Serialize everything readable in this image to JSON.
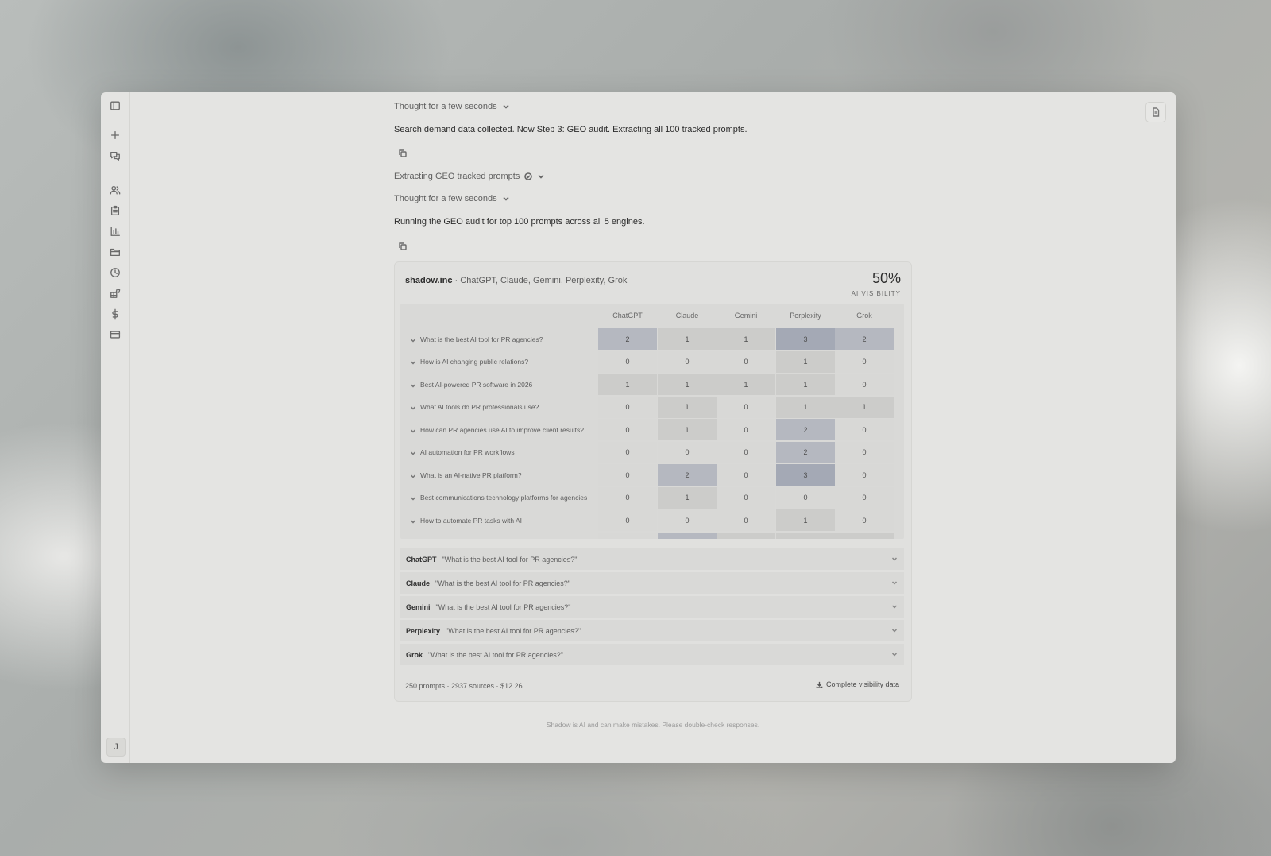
{
  "sidebar": {
    "icons": [
      "panel-toggle-icon",
      "new-chat-icon",
      "chats-icon",
      "people-icon",
      "clipboard-icon",
      "bar-chart-icon",
      "folder-icon",
      "clock-icon",
      "apps-icon",
      "dollar-icon",
      "card-icon"
    ],
    "avatar_initial": "J"
  },
  "chat": {
    "thought1": "Thought for a few seconds",
    "msg1": "Search demand data collected. Now Step 3: GEO audit. Extracting all 100 tracked prompts.",
    "tool_step": "Extracting GEO tracked prompts",
    "thought2": "Thought for a few seconds",
    "msg2": "Running the GEO audit for top 100 prompts across all 5 engines."
  },
  "card": {
    "site": "shadow.inc",
    "engines_line": " · ChatGPT, Claude, Gemini, Perplexity, Grok",
    "visibility_value": "50%",
    "visibility_label": "AI VISIBILITY",
    "columns": [
      "ChatGPT",
      "Claude",
      "Gemini",
      "Perplexity",
      "Grok"
    ],
    "rows": [
      {
        "prompt": "What is the best AI tool for PR agencies?",
        "values": [
          2,
          1,
          1,
          3,
          2
        ]
      },
      {
        "prompt": "How is AI changing public relations?",
        "values": [
          0,
          0,
          0,
          1,
          0
        ]
      },
      {
        "prompt": "Best AI-powered PR software in 2026",
        "values": [
          1,
          1,
          1,
          1,
          0
        ]
      },
      {
        "prompt": "What AI tools do PR professionals use?",
        "values": [
          0,
          1,
          0,
          1,
          1
        ]
      },
      {
        "prompt": "How can PR agencies use AI to improve client results?",
        "values": [
          0,
          1,
          0,
          2,
          0
        ]
      },
      {
        "prompt": "AI automation for PR workflows",
        "values": [
          0,
          0,
          0,
          2,
          0
        ]
      },
      {
        "prompt": "What is an AI-native PR platform?",
        "values": [
          0,
          2,
          0,
          3,
          0
        ]
      },
      {
        "prompt": "Best communications technology platforms for agencies",
        "values": [
          0,
          1,
          0,
          0,
          0
        ]
      },
      {
        "prompt": "How to automate PR tasks with AI",
        "values": [
          0,
          0,
          0,
          1,
          0
        ]
      }
    ],
    "partial_row_levels": [
      0,
      2,
      1,
      1,
      1
    ],
    "responses": [
      {
        "engine": "ChatGPT",
        "query": "\"What is the best AI tool for PR agencies?\""
      },
      {
        "engine": "Claude",
        "query": "\"What is the best AI tool for PR agencies?\""
      },
      {
        "engine": "Gemini",
        "query": "\"What is the best AI tool for PR agencies?\""
      },
      {
        "engine": "Perplexity",
        "query": "\"What is the best AI tool for PR agencies?\""
      },
      {
        "engine": "Grok",
        "query": "\"What is the best AI tool for PR agencies?\""
      }
    ],
    "footer": "250 prompts · 2937 sources · $12.26",
    "download_label": "Complete visibility data"
  },
  "disclaimer": "Shadow is AI and can make mistakes. Please double-check responses."
}
